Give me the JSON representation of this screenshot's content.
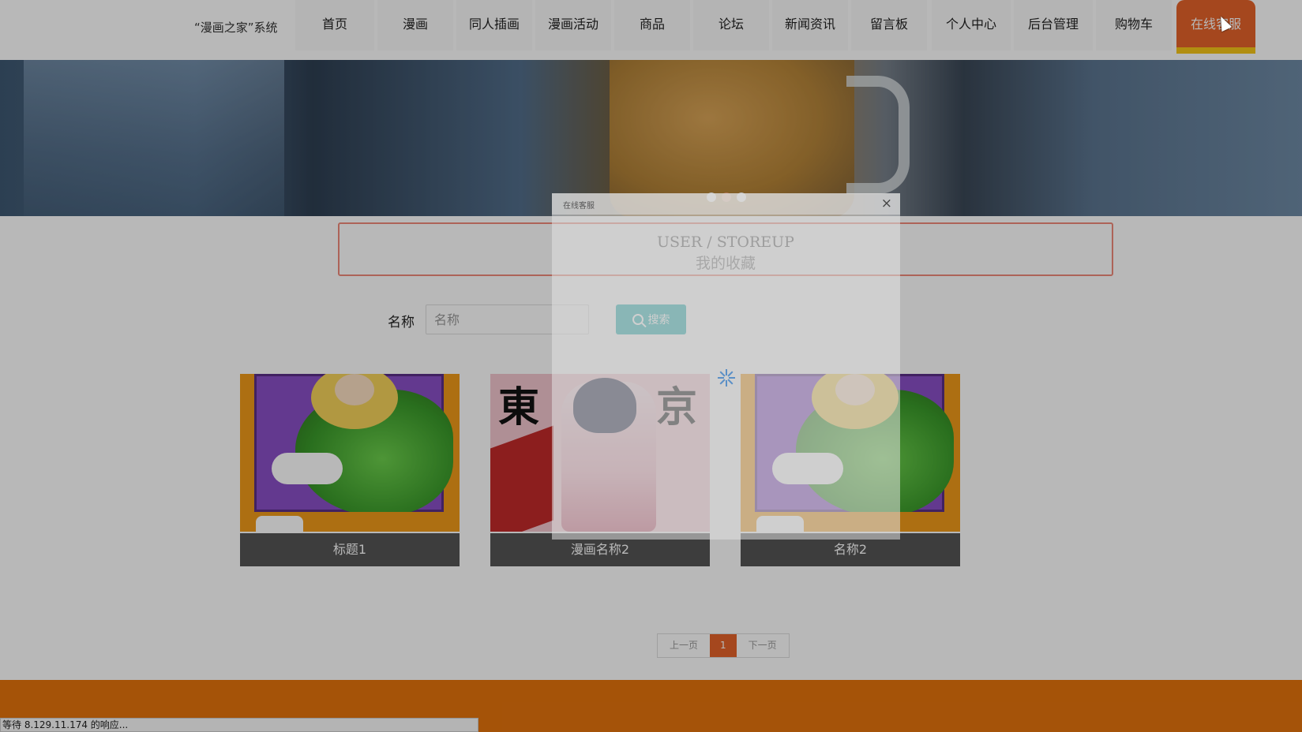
{
  "nav": {
    "brand": "“漫画之家”系统",
    "items": [
      "首页",
      "漫画",
      "同人插画",
      "漫画活动",
      "商品",
      "论坛",
      "新闻资讯",
      "留言板",
      "个人中心",
      "后台管理",
      "购物车",
      "在线客服"
    ],
    "active_index": 11,
    "active_color": "#e5632a",
    "active_underline_color": "#f5c518"
  },
  "banner": {
    "slide_count": 3,
    "active_slide": 2
  },
  "page_title": {
    "en": "USER / STOREUP",
    "cn": "我的收藏"
  },
  "search": {
    "label": "名称",
    "placeholder": "名称",
    "value": "",
    "button_label": "搜索",
    "button_color": "#2ab4b4"
  },
  "cards": [
    {
      "caption": "标题1",
      "art": "dragon"
    },
    {
      "caption": "漫画名称2",
      "art": "girl",
      "cover_text": [
        "東",
        "京"
      ]
    },
    {
      "caption": "名称2",
      "art": "dragon"
    }
  ],
  "pager": {
    "prev": "上一页",
    "current": "1",
    "next": "下一页"
  },
  "dialog": {
    "title": "在线客服",
    "close": "×",
    "loading": true
  },
  "status_bar": "等待 8.129.11.174 的响应...",
  "colors": {
    "footer": "#e5730c",
    "title_border": "#f08a7a"
  }
}
